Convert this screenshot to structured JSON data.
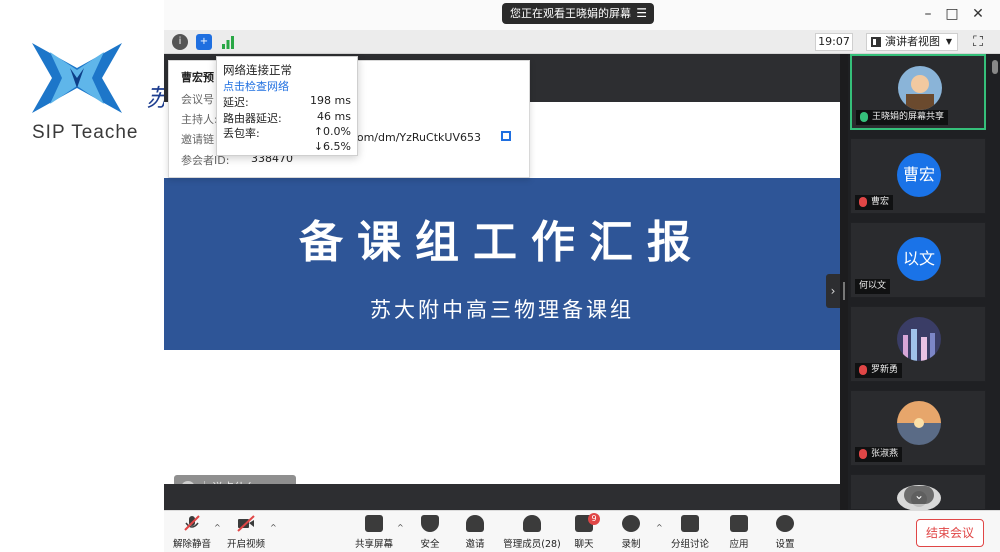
{
  "desktop": {
    "logo_text": "SIP Teache",
    "logo_cn": "苏"
  },
  "titlebar": {
    "viewing": "您正在观看王晓娟的屏幕"
  },
  "toolbar": {
    "clock": "19:07",
    "view_mode": "演讲者视图"
  },
  "info_popup": {
    "title": "曹宏预",
    "meeting_id_label": "会议号",
    "host_label": "主持人:",
    "invite_label": "邀请链",
    "invite_link_visible": "t.com/dm/YzRuCtkUV653",
    "participant_id_label": "参会者ID:",
    "participant_id": "338470"
  },
  "network_popup": {
    "status": "网络连接正常",
    "check_link": "点击检查网络",
    "rows": [
      {
        "label": "延迟:",
        "value": "198 ms"
      },
      {
        "label": "路由器延迟:",
        "value": "46 ms"
      },
      {
        "label": "丢包率:",
        "value": "↑0.0%"
      },
      {
        "label": "",
        "value": "↓6.5%"
      }
    ]
  },
  "slide": {
    "title": "备课组工作汇报",
    "subtitle": "苏大附中高三物理备课组"
  },
  "chat": {
    "placeholder": "说点什么..."
  },
  "participants": [
    {
      "name": "王晓娟的屏幕共享",
      "avatar": "photo",
      "mic": "on"
    },
    {
      "name": "曹宏",
      "avatar": "曹宏",
      "mic": "muted"
    },
    {
      "name": "何以文",
      "avatar": "以文",
      "mic": "none"
    },
    {
      "name": "罗新勇",
      "avatar": "photo",
      "mic": "muted"
    },
    {
      "name": "张淑燕",
      "avatar": "photo",
      "mic": "muted"
    }
  ],
  "controls": {
    "unmute": "解除静音",
    "start_video": "开启视频",
    "share_screen": "共享屏幕",
    "security": "安全",
    "invite": "邀请",
    "manage_members": "管理成员(28)",
    "chat": "聊天",
    "chat_badge": "9",
    "record": "录制",
    "breakout": "分组讨论",
    "apps": "应用",
    "settings": "设置",
    "end_meeting": "结束会议"
  },
  "colors": {
    "accent": "#1a73e8",
    "danger": "#e04646",
    "active_speaker": "#35c07a",
    "slide_banner": "#2e5597"
  }
}
